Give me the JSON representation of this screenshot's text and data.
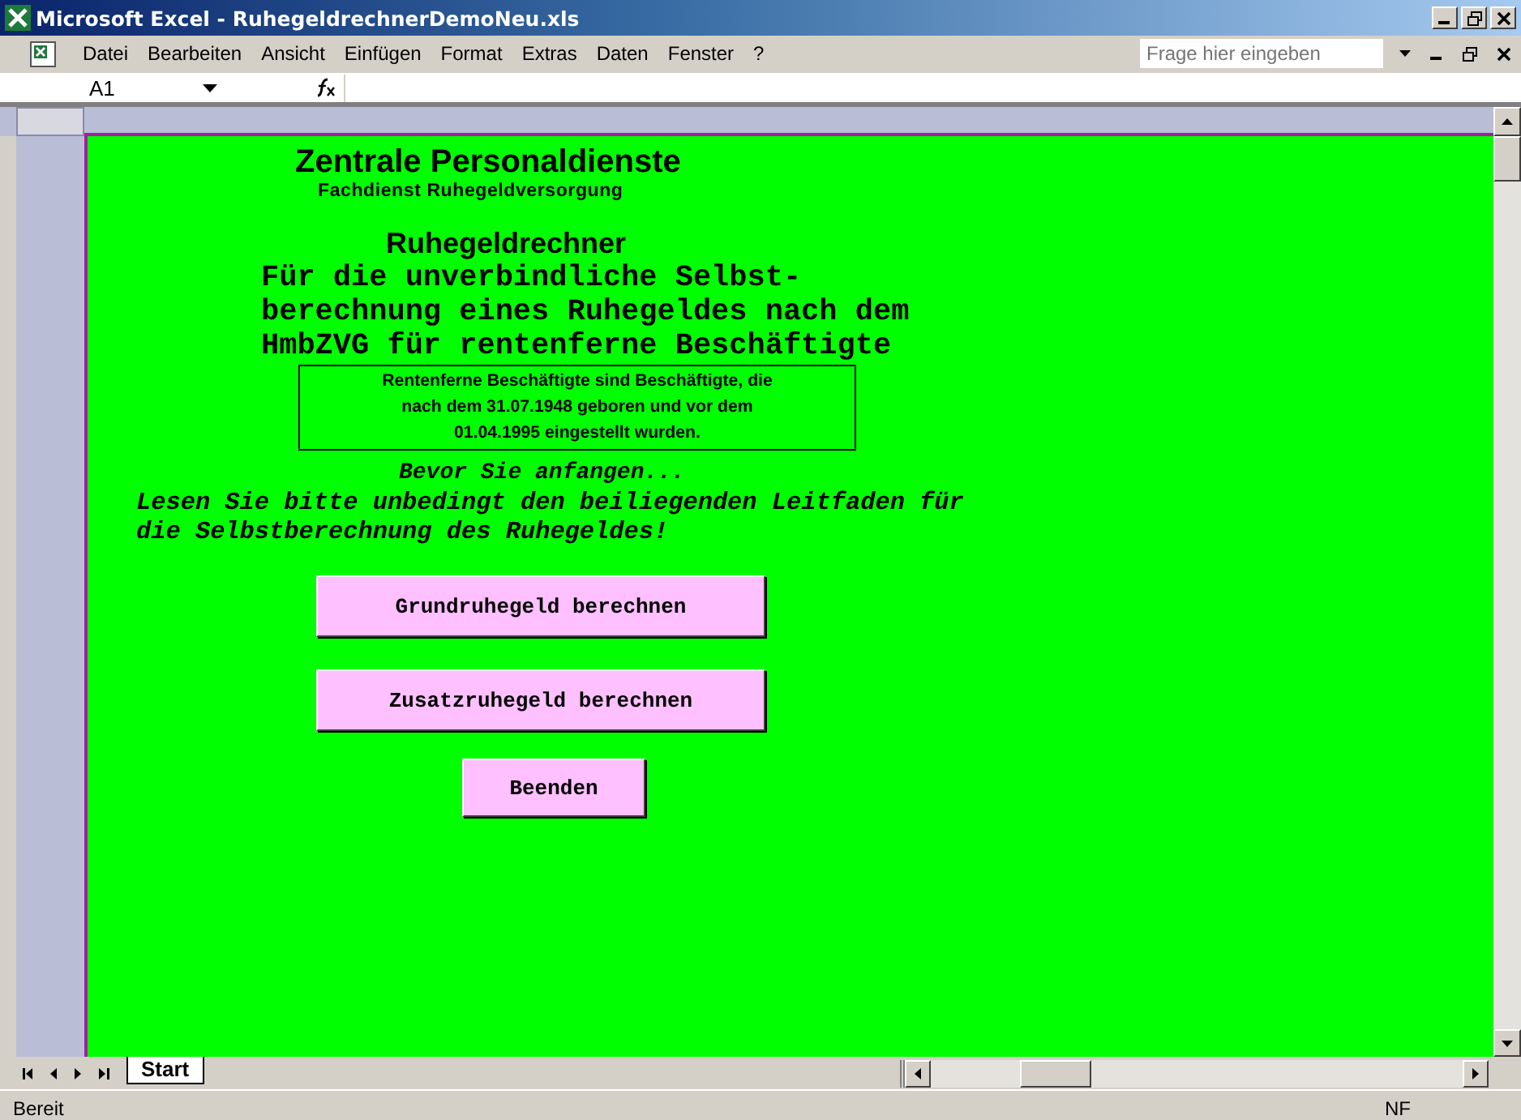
{
  "window": {
    "title": "Microsoft Excel - RuhegeldrechnerDemoNeu.xls"
  },
  "menu": [
    "Datei",
    "Bearbeiten",
    "Ansicht",
    "Einfügen",
    "Format",
    "Extras",
    "Daten",
    "Fenster",
    "?"
  ],
  "help_search": {
    "placeholder": "Frage hier eingeben"
  },
  "name_box": "A1",
  "sheet": {
    "heading": "Zentrale Personaldienste",
    "subheading": "Fachdienst Ruhegeldversorgung",
    "title": "Ruhegeldrechner",
    "intro": [
      "Für die unverbindliche Selbst-",
      "berechnung eines Ruhegeldes nach dem",
      "HmbZVG für rentenferne Beschäftigte"
    ],
    "note": [
      "Rentenferne Beschäftigte sind Beschäftigte, die",
      "nach dem 31.07.1948 geboren und vor dem",
      "01.04.1995 eingestellt wurden."
    ],
    "hint": "Bevor Sie anfangen...",
    "warning": [
      "Lesen Sie bitte unbedingt den beiliegenden Leitfaden für",
      "die Selbstberechnung des Ruhegeldes!"
    ],
    "buttons": [
      {
        "label": "Grundruhegeld berechnen",
        "kind": "wide"
      },
      {
        "label": "Zusatzruhegeld berechnen",
        "kind": "wide"
      },
      {
        "label": "Beenden",
        "kind": "small"
      }
    ]
  },
  "sheet_tabs": [
    {
      "label": "Start",
      "selected": true
    }
  ],
  "status_bar": {
    "text": "Bereit",
    "indicator": "NF"
  }
}
